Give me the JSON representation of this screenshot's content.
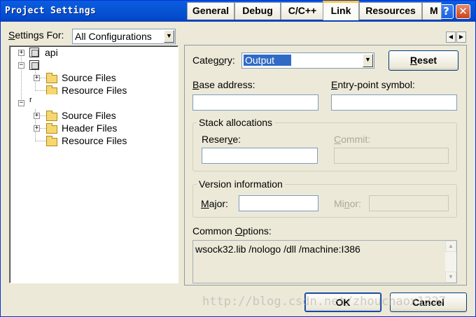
{
  "window": {
    "title": "Project Settings",
    "help_glyph": "?",
    "close_glyph": "✕"
  },
  "left": {
    "settings_for_label": "Settings For:",
    "config_value": "All Configurations",
    "tree": {
      "api": "api",
      "source_files_1": "Source Files",
      "resource_files_1": "Resource Files",
      "proj3": "r",
      "source_files_2": "Source Files",
      "header_files": "Header Files",
      "resource_files_2": "Resource Files"
    }
  },
  "tabs": [
    "General",
    "Debug",
    "C/C++",
    "Link",
    "Resources",
    "M"
  ],
  "active_tab": "Link",
  "link": {
    "category_label": "Category:",
    "category_value": "Output",
    "reset_label": "Reset",
    "base_address_label": "Base address:",
    "base_address_value": "",
    "entry_point_label": "Entry-point symbol:",
    "entry_point_value": "",
    "stack_group": "Stack allocations",
    "reserve_label": "Reserve:",
    "reserve_value": "",
    "commit_label": "Commit:",
    "commit_value": "",
    "version_group": "Version information",
    "major_label": "Major:",
    "major_value": "",
    "minor_label": "Minor:",
    "minor_value": "",
    "common_options_label": "Common Options:",
    "common_options_value": "wsock32.lib /nologo /dll /machine:I386"
  },
  "buttons": {
    "ok": "OK",
    "cancel": "Cancel"
  },
  "watermark": "http://blog.csdn.net/zhouchaox1227",
  "colors": {
    "titlebar": "#0a5ce0",
    "selection": "#316ac5",
    "tab_highlight": "#ffc83c"
  }
}
